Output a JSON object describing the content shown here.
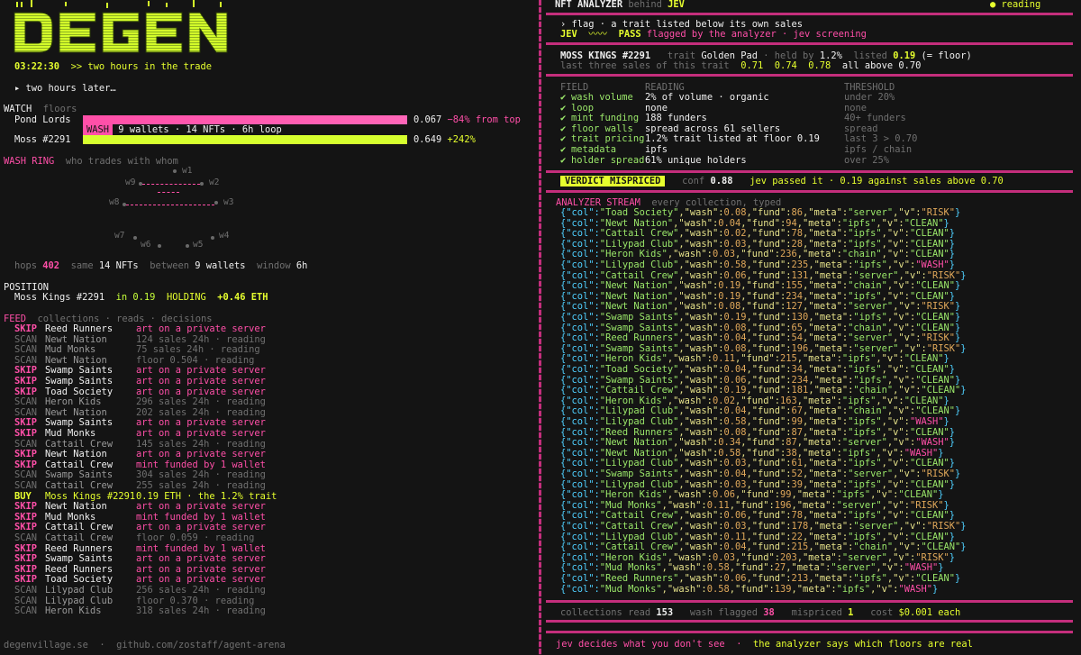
{
  "left": {
    "logo_text": "DEGEN",
    "clock": "03:22:30",
    "clock_note": ">> two hours in the trade",
    "later": "▸ two hours later…",
    "watch": {
      "title": "WATCH",
      "subtitle": "floors",
      "rows": [
        {
          "name": "Pond Lords",
          "value": "0.067",
          "change": "−84% from top"
        },
        {
          "name": "Moss #2291",
          "value": "0.649",
          "change": "+242%"
        }
      ],
      "wash_tag": "WASH",
      "wash_note": "9 wallets · 14 NFTs · 6h loop"
    },
    "ring": {
      "title": "WASH RING",
      "subtitle": "who trades with whom",
      "nodes": [
        "w1",
        "w2",
        "w3",
        "w4",
        "w5",
        "w6",
        "w7",
        "w8",
        "w9"
      ],
      "stats": {
        "hops_label": "hops",
        "hops": "402",
        "same_label": "same",
        "nfts": "14 NFTs",
        "between_label": "between",
        "wallets": "9 wallets",
        "window_label": "window",
        "window": "6h"
      }
    },
    "position": {
      "title": "POSITION",
      "item": "Moss Kings #2291",
      "in": "in",
      "price": "0.19",
      "status": "HOLDING",
      "pnl": "+0.46 ETH"
    },
    "feed": {
      "title": "FEED",
      "subtitle": "collections · reads · decisions",
      "rows": [
        {
          "a": "SKIP",
          "c": "Reed Runners",
          "d": "art on a private server"
        },
        {
          "a": "SCAN",
          "c": "Newt Nation",
          "d": "124 sales 24h · reading"
        },
        {
          "a": "SCAN",
          "c": "Mud Monks",
          "d": "75 sales 24h · reading"
        },
        {
          "a": "SCAN",
          "c": "Newt Nation",
          "d": "floor 0.504 · reading"
        },
        {
          "a": "SKIP",
          "c": "Swamp Saints",
          "d": "art on a private server"
        },
        {
          "a": "SKIP",
          "c": "Swamp Saints",
          "d": "art on a private server"
        },
        {
          "a": "SKIP",
          "c": "Toad Society",
          "d": "art on a private server"
        },
        {
          "a": "SCAN",
          "c": "Heron Kids",
          "d": "296 sales 24h · reading"
        },
        {
          "a": "SCAN",
          "c": "Newt Nation",
          "d": "202 sales 24h · reading"
        },
        {
          "a": "SKIP",
          "c": "Swamp Saints",
          "d": "art on a private server"
        },
        {
          "a": "SKIP",
          "c": "Mud Monks",
          "d": "art on a private server"
        },
        {
          "a": "SCAN",
          "c": "Cattail Crew",
          "d": "145 sales 24h · reading"
        },
        {
          "a": "SKIP",
          "c": "Newt Nation",
          "d": "art on a private server"
        },
        {
          "a": "SKIP",
          "c": "Cattail Crew",
          "d": "mint funded by 1 wallet"
        },
        {
          "a": "SCAN",
          "c": "Swamp Saints",
          "d": "304 sales 24h · reading"
        },
        {
          "a": "SCAN",
          "c": "Cattail Crew",
          "d": "255 sales 24h · reading"
        },
        {
          "a": "BUY",
          "c": "Moss Kings #2291",
          "d": "0.19 ETH · the 1.2% trait"
        },
        {
          "a": "SKIP",
          "c": "Newt Nation",
          "d": "art on a private server"
        },
        {
          "a": "SKIP",
          "c": "Mud Monks",
          "d": "mint funded by 1 wallet"
        },
        {
          "a": "SKIP",
          "c": "Cattail Crew",
          "d": "art on a private server"
        },
        {
          "a": "SCAN",
          "c": "Cattail Crew",
          "d": "floor 0.059 · reading"
        },
        {
          "a": "SKIP",
          "c": "Reed Runners",
          "d": "mint funded by 1 wallet"
        },
        {
          "a": "SKIP",
          "c": "Swamp Saints",
          "d": "art on a private server"
        },
        {
          "a": "SKIP",
          "c": "Reed Runners",
          "d": "art on a private server"
        },
        {
          "a": "SKIP",
          "c": "Toad Society",
          "d": "art on a private server"
        },
        {
          "a": "SCAN",
          "c": "Lilypad Club",
          "d": "256 sales 24h · reading"
        },
        {
          "a": "SCAN",
          "c": "Lilypad Club",
          "d": "floor 0.370 · reading"
        },
        {
          "a": "SCAN",
          "c": "Heron Kids",
          "d": "318 sales 24h · reading"
        }
      ]
    },
    "footer": {
      "site": "degenvillage.se",
      "sep": "·",
      "repo": "github.com/zostaff/agent-arena"
    }
  },
  "right": {
    "header": {
      "title": "NFT ANALYZER",
      "behind": "behind",
      "agent": "JEV",
      "status": "● reading"
    },
    "flag": {
      "line": "› flag · a trait listed below its own sales",
      "agent": "JEV",
      "wave": "〰〰",
      "pass": "PASS",
      "note": "flagged by the analyzer · jev screening"
    },
    "item": {
      "name": "MOSS KINGS #2291",
      "trait_label": "trait",
      "trait": "Golden Pad",
      "held_label": "· held by",
      "held": "1.2%",
      "listed_label": "listed",
      "listed": "0.19",
      "listed_note": "(= floor)",
      "sales_label": "last three sales of this trait",
      "sales": [
        "0.71",
        "0.74",
        "0.78"
      ],
      "sales_note": "all above 0.70"
    },
    "table": {
      "headers": [
        "FIELD",
        "READING",
        "THRESHOLD"
      ],
      "rows": [
        {
          "f": "wash volume",
          "r": "2% of volume · organic",
          "t": "under 20%"
        },
        {
          "f": "loop",
          "r": "none",
          "t": "none"
        },
        {
          "f": "mint funding",
          "r": "188 funders",
          "t": "40+ funders"
        },
        {
          "f": "floor walls",
          "r": "spread across 61 sellers",
          "t": "spread"
        },
        {
          "f": "trait pricing",
          "r": "1.2% trait listed at floor 0.19",
          "t": "last 3 > 0.70"
        },
        {
          "f": "metadata",
          "r": "ipfs",
          "t": "ipfs / chain"
        },
        {
          "f": "holder spread",
          "r": "61% unique holders",
          "t": "over 25%"
        }
      ]
    },
    "verdict": {
      "tag": "VERDICT MISPRICED",
      "conf_label": "conf",
      "conf": "0.88",
      "note": "jev passed it · 0.19 against sales above 0.70"
    },
    "stream": {
      "title": "ANALYZER STREAM",
      "subtitle": "every collection, typed",
      "rows": [
        [
          "Toad Society",
          "0.08",
          "86",
          "server",
          "RISK"
        ],
        [
          "Newt Nation",
          "0.04",
          "94",
          "ipfs",
          "CLEAN"
        ],
        [
          "Cattail Crew",
          "0.02",
          "78",
          "ipfs",
          "CLEAN"
        ],
        [
          "Lilypad Club",
          "0.03",
          "28",
          "ipfs",
          "CLEAN"
        ],
        [
          "Heron Kids",
          "0.03",
          "236",
          "chain",
          "CLEAN"
        ],
        [
          "Lilypad Club",
          "0.58",
          "235",
          "ipfs",
          "WASH"
        ],
        [
          "Cattail Crew",
          "0.06",
          "131",
          "server",
          "RISK"
        ],
        [
          "Newt Nation",
          "0.19",
          "155",
          "chain",
          "CLEAN"
        ],
        [
          "Newt Nation",
          "0.19",
          "234",
          "ipfs",
          "CLEAN"
        ],
        [
          "Newt Nation",
          "0.08",
          "127",
          "server",
          "RISK"
        ],
        [
          "Swamp Saints",
          "0.19",
          "130",
          "ipfs",
          "CLEAN"
        ],
        [
          "Swamp Saints",
          "0.08",
          "65",
          "chain",
          "CLEAN"
        ],
        [
          "Reed Runners",
          "0.04",
          "54",
          "server",
          "RISK"
        ],
        [
          "Swamp Saints",
          "0.08",
          "196",
          "server",
          "RISK"
        ],
        [
          "Heron Kids",
          "0.11",
          "215",
          "ipfs",
          "CLEAN"
        ],
        [
          "Toad Society",
          "0.04",
          "34",
          "ipfs",
          "CLEAN"
        ],
        [
          "Swamp Saints",
          "0.06",
          "234",
          "ipfs",
          "CLEAN"
        ],
        [
          "Cattail Crew",
          "0.19",
          "181",
          "chain",
          "CLEAN"
        ],
        [
          "Heron Kids",
          "0.02",
          "163",
          "ipfs",
          "CLEAN"
        ],
        [
          "Lilypad Club",
          "0.04",
          "67",
          "chain",
          "CLEAN"
        ],
        [
          "Lilypad Club",
          "0.58",
          "99",
          "ipfs",
          "WASH"
        ],
        [
          "Reed Runners",
          "0.08",
          "87",
          "ipfs",
          "CLEAN"
        ],
        [
          "Newt Nation",
          "0.34",
          "87",
          "server",
          "WASH"
        ],
        [
          "Newt Nation",
          "0.58",
          "38",
          "ipfs",
          "WASH"
        ],
        [
          "Lilypad Club",
          "0.03",
          "61",
          "ipfs",
          "CLEAN"
        ],
        [
          "Swamp Saints",
          "0.04",
          "52",
          "server",
          "RISK"
        ],
        [
          "Lilypad Club",
          "0.03",
          "39",
          "ipfs",
          "CLEAN"
        ],
        [
          "Heron Kids",
          "0.06",
          "99",
          "ipfs",
          "CLEAN"
        ],
        [
          "Mud Monks",
          "0.11",
          "196",
          "server",
          "RISK"
        ],
        [
          "Cattail Crew",
          "0.06",
          "78",
          "ipfs",
          "CLEAN"
        ],
        [
          "Cattail Crew",
          "0.03",
          "178",
          "server",
          "RISK"
        ],
        [
          "Lilypad Club",
          "0.11",
          "22",
          "ipfs",
          "CLEAN"
        ],
        [
          "Cattail Crew",
          "0.04",
          "215",
          "chain",
          "CLEAN"
        ],
        [
          "Heron Kids",
          "0.03",
          "203",
          "server",
          "RISK"
        ],
        [
          "Mud Monks",
          "0.58",
          "27",
          "server",
          "WASH"
        ],
        [
          "Reed Runners",
          "0.06",
          "213",
          "ipfs",
          "CLEAN"
        ],
        [
          "Mud Monks",
          "0.58",
          "139",
          "ipfs",
          "WASH"
        ]
      ]
    },
    "stats": {
      "read_label": "collections read",
      "read": "153",
      "wash_label": "wash flagged",
      "wash": "38",
      "mis_label": "mispriced",
      "mis": "1",
      "cost_label": "cost",
      "cost": "$0.001 each"
    },
    "footer": {
      "a": "jev decides what you don't see",
      "sep": "·",
      "b": "the analyzer says which floors are real"
    }
  }
}
